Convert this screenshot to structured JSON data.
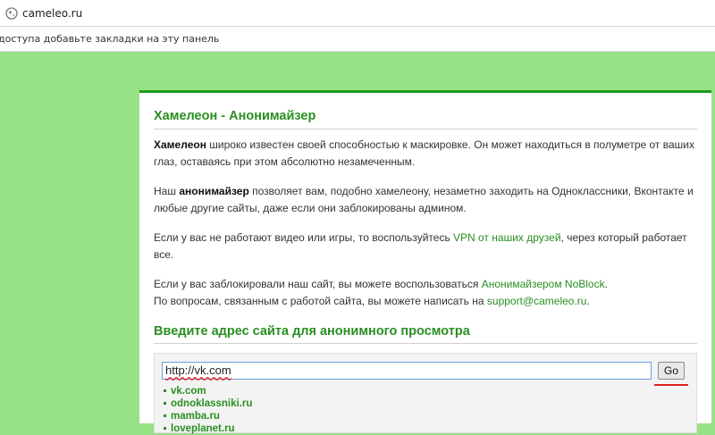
{
  "browser": {
    "url": "cameleo.ru",
    "bookmarks_hint": "доступа добавьте закладки на эту панель"
  },
  "panel": {
    "title": "Хамелеон - Анонимайзер",
    "p1": {
      "bold": "Хамелеон",
      "text": " широко известен своей способностью к маскировке. Он может находиться в полуметре от ваших глаз, оставаясь при этом абсолютно незамеченным."
    },
    "p2": {
      "before": "Наш ",
      "bold": "анонимайзер",
      "after": " позволяет вам, подобно хамелеону, незаметно заходить на Одноклассники, Вконтакте и любые другие сайты, даже если они заблокированы админом."
    },
    "p3": {
      "before": "Если у вас не работают видео или игры, то воспользуйтесь ",
      "link": "VPN от наших друзей",
      "after": ", через который работает все."
    },
    "p4": {
      "before": "Если у вас заблокировали наш сайт, вы можете воспользоваться ",
      "link": "Анонимайзером NoBlock",
      "after": "."
    },
    "p5": {
      "before": "По вопросам, связанным с работой сайта, вы можете написать на ",
      "link": "support@cameleo.ru",
      "after": "."
    },
    "section_title": "Введите адрес сайта для анонимного просмотра",
    "form": {
      "input_value": "http://vk.com",
      "go_label": "Go"
    },
    "sites": [
      "vk.com",
      "odnoklassniki.ru",
      "mamba.ru",
      "loveplanet.ru"
    ]
  },
  "colors": {
    "background": "#97e187",
    "accent_green": "#2a8f22",
    "panel_border": "#1c9a1c"
  }
}
